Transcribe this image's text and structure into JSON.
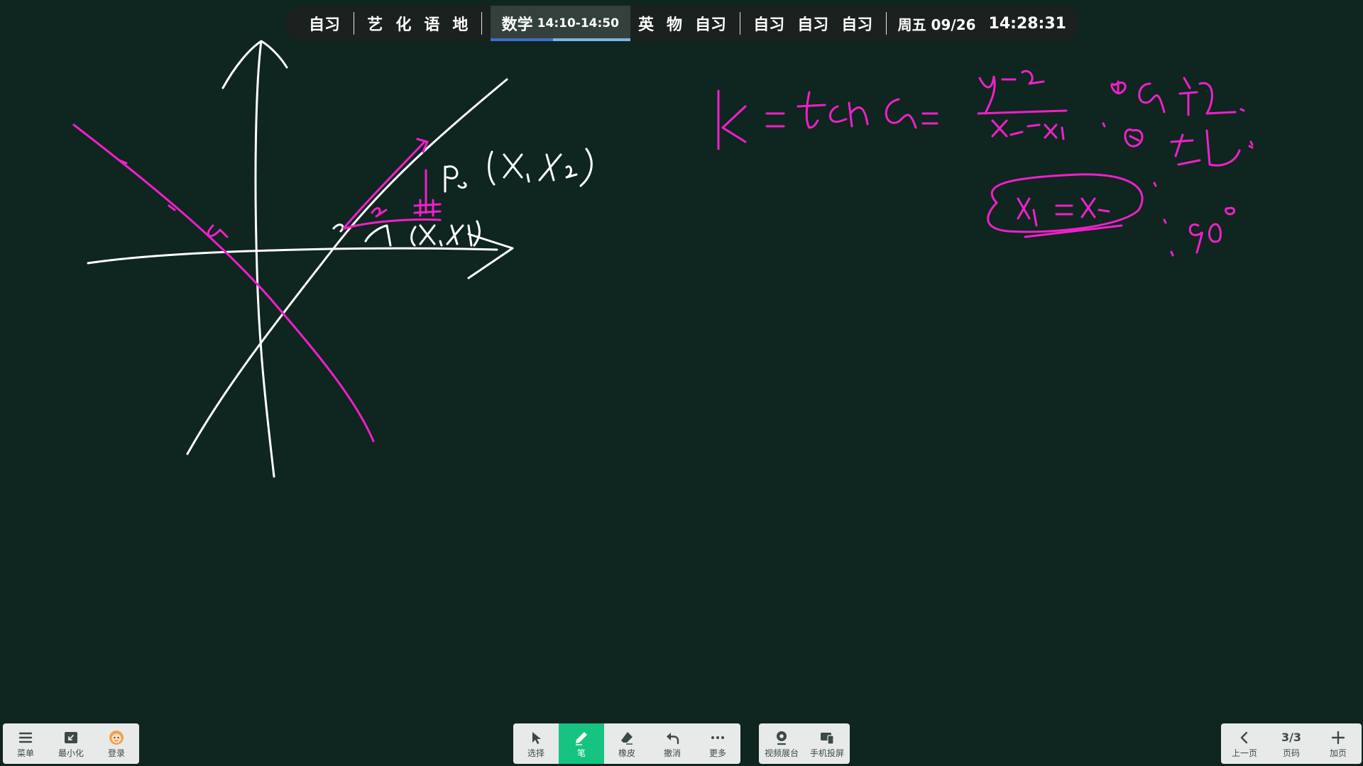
{
  "schedule": {
    "items": [
      "自习",
      "艺",
      "化",
      "语",
      "地"
    ],
    "current": {
      "subject": "数学",
      "time": "14:10-14:50",
      "progress": 0.45
    },
    "items_after": [
      "英",
      "物",
      "自习"
    ],
    "items_evening": [
      "自习",
      "自习",
      "自习"
    ],
    "date": "周五 09/26",
    "clock": "14:28:31"
  },
  "colors": {
    "ink_white": "#ffffff",
    "ink_magenta": "#f020c8",
    "accent_green": "#16c380",
    "board": "#0f2520"
  },
  "left_toolbar": [
    {
      "label": "菜单",
      "icon": "menu-icon"
    },
    {
      "label": "最小化",
      "icon": "minimize-icon"
    },
    {
      "label": "登录",
      "icon": "avatar-icon"
    }
  ],
  "center_toolbar": [
    {
      "label": "选择",
      "icon": "cursor-icon"
    },
    {
      "label": "笔",
      "icon": "pen-icon",
      "active": true
    },
    {
      "label": "橡皮",
      "icon": "eraser-icon"
    },
    {
      "label": "撤消",
      "icon": "undo-icon"
    },
    {
      "label": "更多",
      "icon": "more-icon"
    }
  ],
  "media_toolbar": [
    {
      "label": "视频展台",
      "icon": "camera-icon"
    },
    {
      "label": "手机投屏",
      "icon": "phone-cast-icon"
    }
  ],
  "page_toolbar": {
    "prev_label": "上一页",
    "page_indicator": "3/3",
    "page_label": "页码",
    "add_label": "加页"
  }
}
